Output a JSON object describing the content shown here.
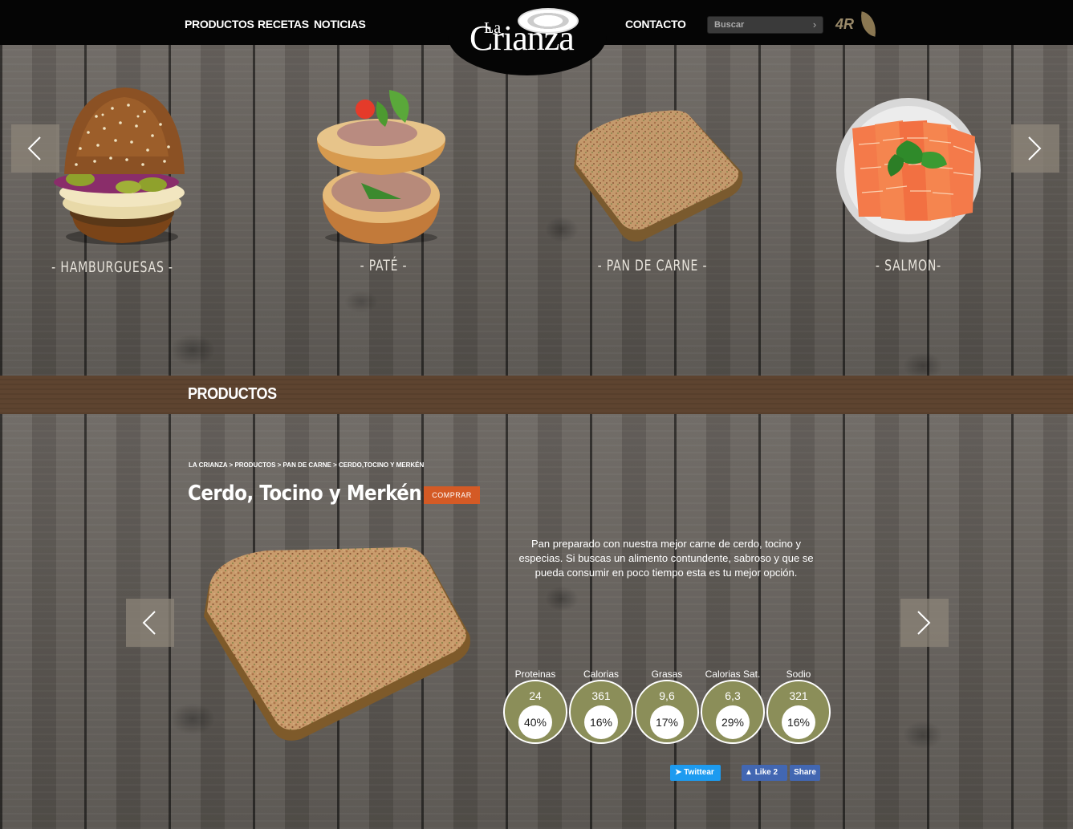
{
  "header": {
    "nav": [
      "PRODUCTOS",
      "RECETAS",
      "NOTICIAS",
      "CONTACTO"
    ],
    "logo_la": "La",
    "logo_name": "Crianza",
    "search_placeholder": "Buscar",
    "brand_badge": "4R"
  },
  "carousel": {
    "items": [
      {
        "label": "- HAMBURGUESAS -",
        "icon": "burger-image"
      },
      {
        "label": "- PATÉ -",
        "icon": "pate-image"
      },
      {
        "label": "- PAN DE CARNE -",
        "icon": "meatloaf-image"
      },
      {
        "label": "- SALMON-",
        "icon": "salmon-image"
      }
    ]
  },
  "section": {
    "title": "PRODUCTOS"
  },
  "breadcrumb": [
    "LA CRIANZA",
    "PRODUCTOS",
    "PAN DE CARNE",
    "CERDO,TOCINO Y MERKÉN"
  ],
  "breadcrumb_separator": ">",
  "product": {
    "title": "Cerdo, Tocino y Merkén",
    "buy_label": "COMPRAR",
    "description": "Pan preparado con nuestra mejor carne de cerdo, tocino y especias. Si buscas un alimento contundente, sabroso y que se pueda consumir en poco tiempo esta es tu mejor opción."
  },
  "nutrition": [
    {
      "label": "Proteinas",
      "value": "24",
      "percent": "40%"
    },
    {
      "label": "Calorias",
      "value": "361",
      "percent": "16%"
    },
    {
      "label": "Grasas",
      "value": "9,6",
      "percent": "17%"
    },
    {
      "label": "Calorias Sat.",
      "value": "6,3",
      "percent": "29%"
    },
    {
      "label": "Sodio",
      "value": "321",
      "percent": "16%"
    }
  ],
  "social": {
    "tweet": "Twittear",
    "like": "Like 2",
    "share": "Share"
  },
  "colors": {
    "header_bg": "#050505",
    "band_bg": "#5e4430",
    "buy_button": "#d45a25",
    "nutrition_circle": "#8b8e59",
    "twitter": "#1d9bf0",
    "facebook": "#4267b2"
  }
}
